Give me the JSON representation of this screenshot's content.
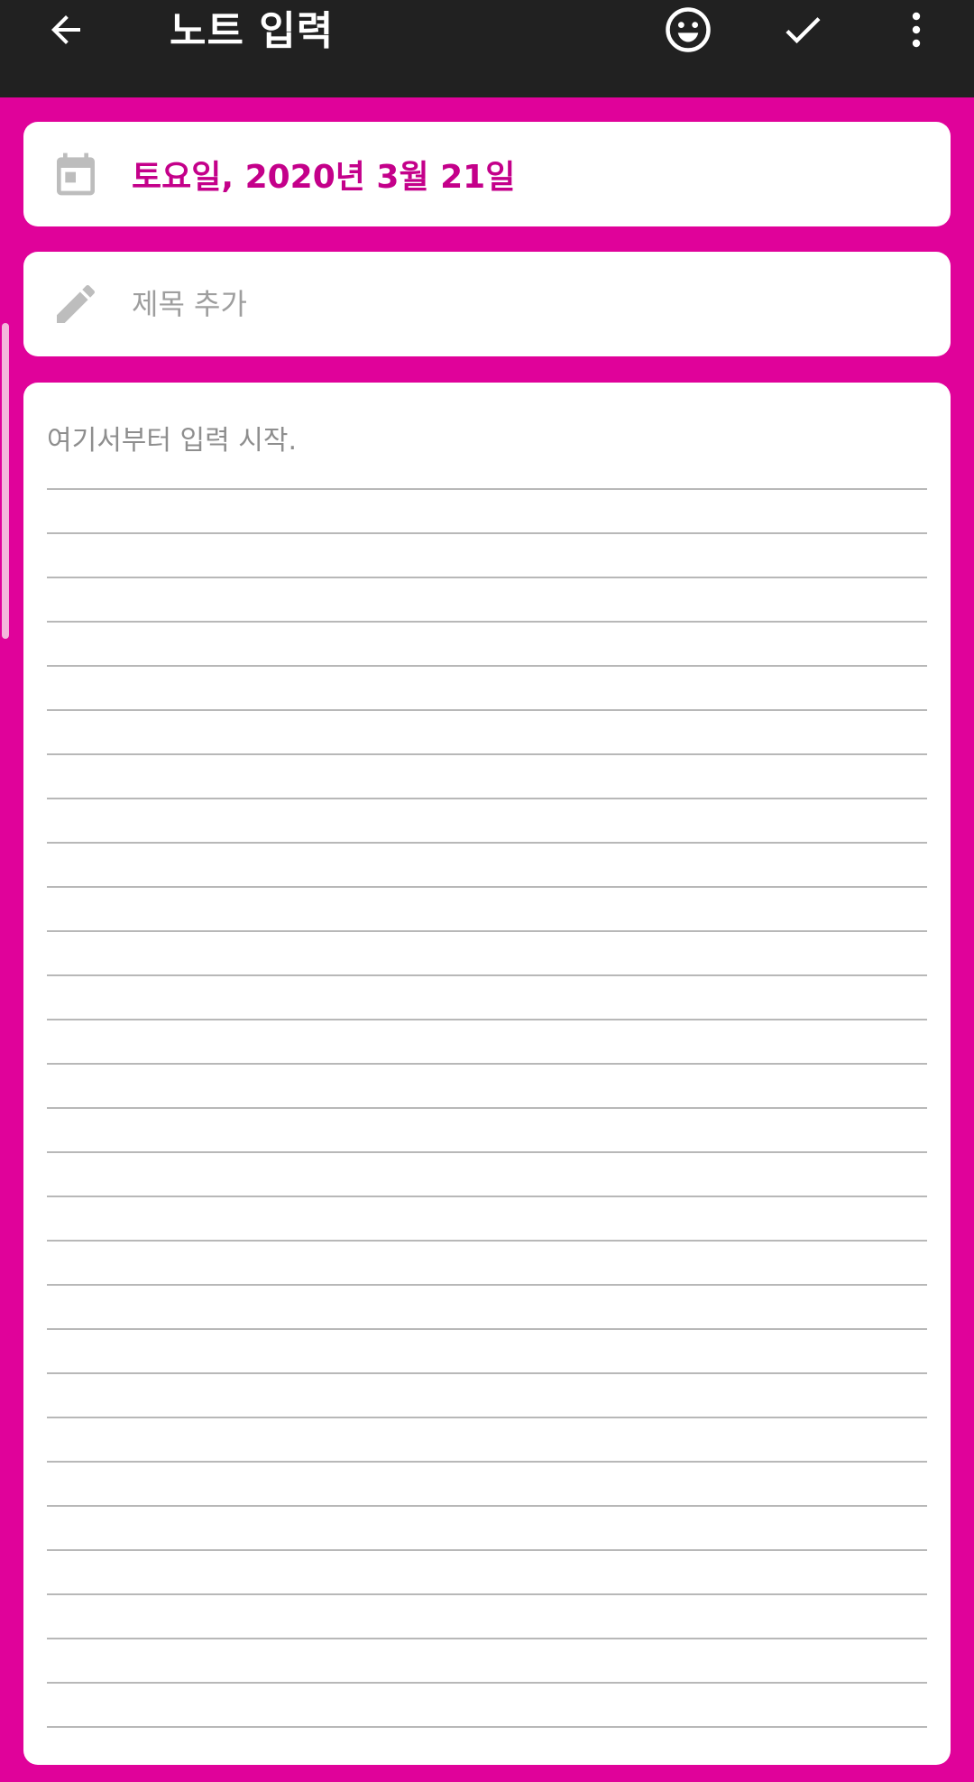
{
  "appbar": {
    "title": "노트 입력",
    "icons": {
      "back": "arrow-left-icon",
      "mood": "smiley-icon",
      "confirm": "check-icon",
      "more": "more-vertical-icon"
    }
  },
  "date_field": {
    "icon": "calendar-icon",
    "value": "토요일, 2020년 3월 21일"
  },
  "title_field": {
    "icon": "pencil-icon",
    "placeholder": "제목 추가",
    "value": ""
  },
  "note_field": {
    "placeholder": "여기서부터 입력 시작.",
    "value": ""
  },
  "colors": {
    "accent": "#e0029a",
    "date_text": "#c4008a",
    "appbar": "#212121"
  }
}
